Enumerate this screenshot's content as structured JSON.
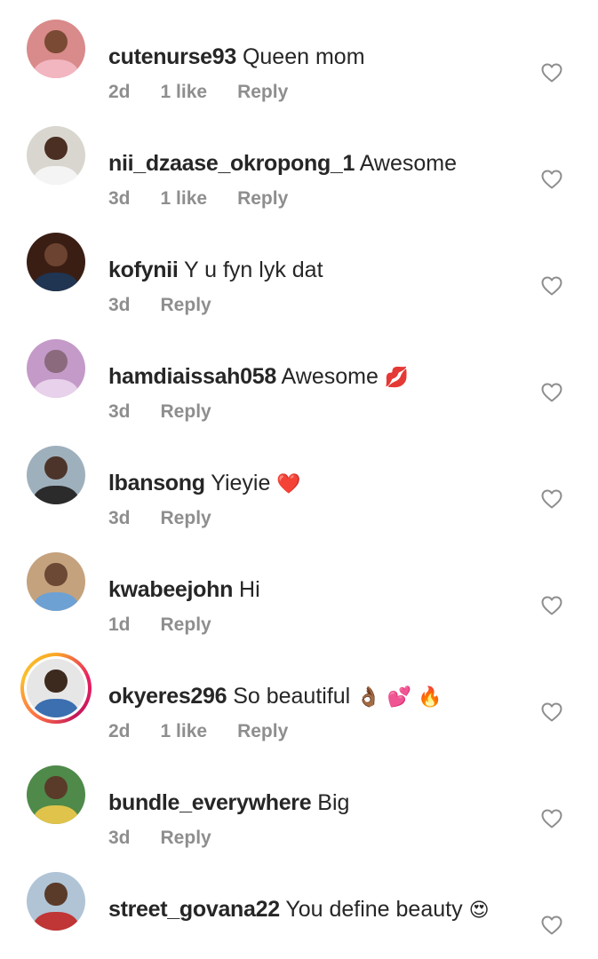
{
  "comments": [
    {
      "username": "cutenurse93",
      "text": "Queen mom",
      "emoji": "",
      "age": "2d",
      "likes": "1 like",
      "reply": "Reply",
      "avatar": {
        "bg": "#d98a8a",
        "skin": "#7a4a34",
        "shirt": "#f2b6c1"
      }
    },
    {
      "username": "nii_dzaase_okropong_1",
      "text": "Awesome",
      "emoji": "",
      "age": "3d",
      "likes": "1 like",
      "reply": "Reply",
      "avatar": {
        "bg": "#d9d6cf",
        "skin": "#4a2f22",
        "shirt": "#f4f4f4"
      }
    },
    {
      "username": "kofynii",
      "text": "Y u fyn lyk dat",
      "emoji": "",
      "age": "3d",
      "likes": "",
      "reply": "Reply",
      "avatar": {
        "bg": "#3a1e14",
        "skin": "#6b4330",
        "shirt": "#1f3552"
      }
    },
    {
      "username": "hamdiaissah058",
      "text": "Awesome",
      "emoji": "💋",
      "age": "3d",
      "likes": "",
      "reply": "Reply",
      "avatar": {
        "bg": "#c49ac8",
        "skin": "#8b6a7d",
        "shirt": "#e8d1ea"
      }
    },
    {
      "username": "lbansong",
      "text": "Yieyie",
      "emoji": "❤️",
      "age": "3d",
      "likes": "",
      "reply": "Reply",
      "avatar": {
        "bg": "#9fb0bd",
        "skin": "#4d342a",
        "shirt": "#2b2b2b"
      }
    },
    {
      "username": "kwabeejohn",
      "text": "Hi",
      "emoji": "",
      "age": "1d",
      "likes": "",
      "reply": "Reply",
      "avatar": {
        "bg": "#c4a27d",
        "skin": "#6b4935",
        "shirt": "#6ea1d3"
      }
    },
    {
      "username": "okyeres296",
      "text": "So beautiful",
      "emoji": "👌🏾 💕 🔥",
      "age": "2d",
      "likes": "1 like",
      "reply": "Reply",
      "story_ring": true,
      "avatar": {
        "bg": "#e6e6e6",
        "skin": "#3d2a1f",
        "shirt": "#3b6fb0"
      }
    },
    {
      "username": "bundle_everywhere",
      "text": "Big",
      "emoji": "",
      "age": "3d",
      "likes": "",
      "reply": "Reply",
      "avatar": {
        "bg": "#4f8a4a",
        "skin": "#5a3b29",
        "shirt": "#e0c34a"
      }
    },
    {
      "username": "street_govana22",
      "text": "You define beauty",
      "emoji": "😍",
      "age": "",
      "likes": "",
      "reply": "",
      "avatar": {
        "bg": "#b0c4d6",
        "skin": "#5a3b29",
        "shirt": "#c03535"
      }
    }
  ],
  "icons": {
    "heart": "heart-outline-icon"
  },
  "colors": {
    "username": "#262626",
    "meta": "#8e8e8e",
    "heart": "#8e8e8e"
  }
}
